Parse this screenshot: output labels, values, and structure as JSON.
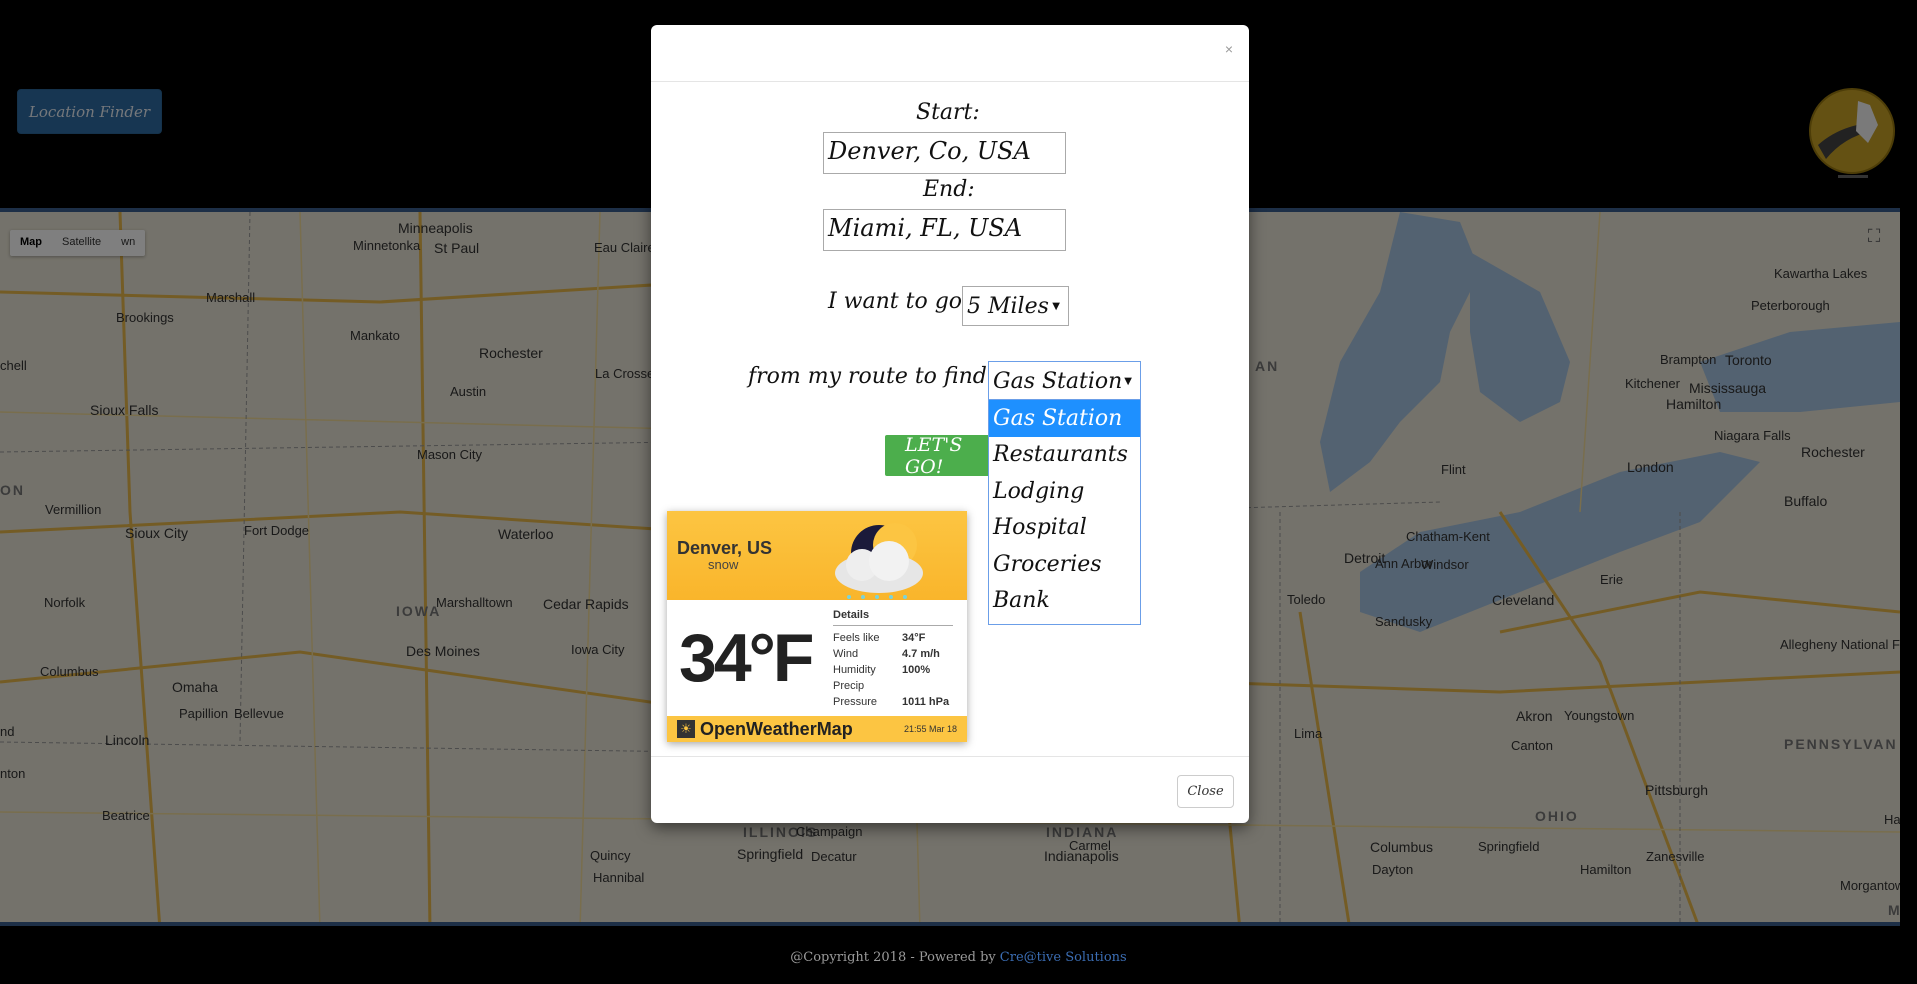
{
  "header": {
    "finder_button": "Location Finder"
  },
  "map": {
    "type_controls": [
      "Map",
      "Satellite",
      "wn"
    ],
    "labels": [
      {
        "text": "Minneapolis",
        "cls": "big"
      },
      {
        "text": "St Paul",
        "cls": "big"
      },
      {
        "text": "Minnetonka",
        "cls": ""
      },
      {
        "text": "Eau Claire",
        "cls": ""
      },
      {
        "text": "Marshall",
        "cls": ""
      },
      {
        "text": "Brookings",
        "cls": ""
      },
      {
        "text": "Mankato",
        "cls": ""
      },
      {
        "text": "Rochester",
        "cls": "big"
      },
      {
        "text": "Austin",
        "cls": ""
      },
      {
        "text": "La Crosse",
        "cls": ""
      },
      {
        "text": "Sioux Falls",
        "cls": "big"
      },
      {
        "text": "Mason City",
        "cls": ""
      },
      {
        "text": "Vermillion",
        "cls": ""
      },
      {
        "text": "Sioux City",
        "cls": "big"
      },
      {
        "text": "Fort Dodge",
        "cls": ""
      },
      {
        "text": "Waterloo",
        "cls": "big"
      },
      {
        "text": "Norfolk",
        "cls": ""
      },
      {
        "text": "IOWA",
        "cls": "state"
      },
      {
        "text": "Marshalltown",
        "cls": ""
      },
      {
        "text": "Cedar Rapids",
        "cls": "big"
      },
      {
        "text": "Des Moines",
        "cls": "big"
      },
      {
        "text": "Iowa City",
        "cls": ""
      },
      {
        "text": "Columbus",
        "cls": ""
      },
      {
        "text": "Omaha",
        "cls": "big"
      },
      {
        "text": "Papillion",
        "cls": ""
      },
      {
        "text": "Bellevue",
        "cls": ""
      },
      {
        "text": "Lincoln",
        "cls": "big"
      },
      {
        "text": "Beatrice",
        "cls": ""
      },
      {
        "text": "Kawartha Lakes",
        "cls": ""
      },
      {
        "text": "Peterborough",
        "cls": ""
      },
      {
        "text": "Brampton",
        "cls": ""
      },
      {
        "text": "Toronto",
        "cls": "big"
      },
      {
        "text": "Kitchener",
        "cls": ""
      },
      {
        "text": "Mississauga",
        "cls": "big"
      },
      {
        "text": "Hamilton",
        "cls": "big"
      },
      {
        "text": "Niagara Falls",
        "cls": ""
      },
      {
        "text": "Rochester",
        "cls": "big"
      },
      {
        "text": "Buffalo",
        "cls": "big"
      },
      {
        "text": "London",
        "cls": "big"
      },
      {
        "text": "Flint",
        "cls": ""
      },
      {
        "text": "Chatham-Kent",
        "cls": ""
      },
      {
        "text": "Ann Arbor",
        "cls": ""
      },
      {
        "text": "Detroit",
        "cls": "big"
      },
      {
        "text": "Windsor",
        "cls": ""
      },
      {
        "text": "Erie",
        "cls": ""
      },
      {
        "text": "Toledo",
        "cls": ""
      },
      {
        "text": "Sandusky",
        "cls": ""
      },
      {
        "text": "Cleveland",
        "cls": "big"
      },
      {
        "text": "Allegheny National Forest",
        "cls": ""
      },
      {
        "text": "Akron",
        "cls": "big"
      },
      {
        "text": "Youngstown",
        "cls": ""
      },
      {
        "text": "Lima",
        "cls": ""
      },
      {
        "text": "Canton",
        "cls": ""
      },
      {
        "text": "PENNSYLVAN",
        "cls": "state"
      },
      {
        "text": "Pittsburgh",
        "cls": "big"
      },
      {
        "text": "OHIO",
        "cls": "state"
      },
      {
        "text": "Columbus",
        "cls": "big"
      },
      {
        "text": "Springfield",
        "cls": ""
      },
      {
        "text": "Zanesville",
        "cls": ""
      },
      {
        "text": "Dayton",
        "cls": ""
      },
      {
        "text": "Harris",
        "cls": ""
      },
      {
        "text": "Morgantown",
        "cls": ""
      },
      {
        "text": "MA",
        "cls": "state"
      },
      {
        "text": "Hamilton",
        "cls": ""
      },
      {
        "text": "ILLINOIS",
        "cls": "state"
      },
      {
        "text": "INDIANA",
        "cls": "state"
      },
      {
        "text": "Champaign",
        "cls": ""
      },
      {
        "text": "Carmel",
        "cls": ""
      },
      {
        "text": "Springfield",
        "cls": "big"
      },
      {
        "text": "Decatur",
        "cls": ""
      },
      {
        "text": "Indianapolis",
        "cls": "big"
      },
      {
        "text": "Quincy",
        "cls": ""
      },
      {
        "text": "Hannibal",
        "cls": ""
      },
      {
        "text": "AN",
        "cls": "state"
      },
      {
        "text": "chell",
        "cls": ""
      },
      {
        "text": "ON",
        "cls": "state"
      },
      {
        "text": "nd",
        "cls": ""
      },
      {
        "text": "nton",
        "cls": ""
      }
    ]
  },
  "modal": {
    "close_x": "×",
    "start_label": "Start:",
    "start_value": "Denver, Co, USA",
    "end_label": "End:",
    "end_value": "Miami, FL, USA",
    "distance_prefix": "I want to go",
    "distance_value": "5 Miles",
    "find_prefix": "from my route to find",
    "find_value": "Gas Station",
    "find_options": [
      "Gas Station",
      "Restaurants",
      "Lodging",
      "Hospital",
      "Groceries",
      "Bank"
    ],
    "go_button": "LET'S GO!",
    "close_button": "Close"
  },
  "weather": {
    "city": "Denver, US",
    "description": "snow",
    "temperature": "34°F",
    "details_title": "Details",
    "details": [
      {
        "label": "Feels like",
        "value": "34°F"
      },
      {
        "label": "Wind",
        "value": "4.7 m/h"
      },
      {
        "label": "Humidity",
        "value": "100%"
      },
      {
        "label": "Precip",
        "value": ""
      },
      {
        "label": "Pressure",
        "value": "1011 hPa"
      }
    ],
    "brand": "OpenWeatherMap",
    "time": "21:55 Mar 18"
  },
  "footer": {
    "copyright": "@Copyright 2018 - Powered by",
    "brand": "Cre@tive Solutions"
  },
  "colors": {
    "header_bg": "#000000",
    "finder_btn": "#2e6da4",
    "go_btn": "#4cae4c",
    "dropdown_selected": "#1e90ff",
    "weather_yellow": "#fcc542"
  }
}
